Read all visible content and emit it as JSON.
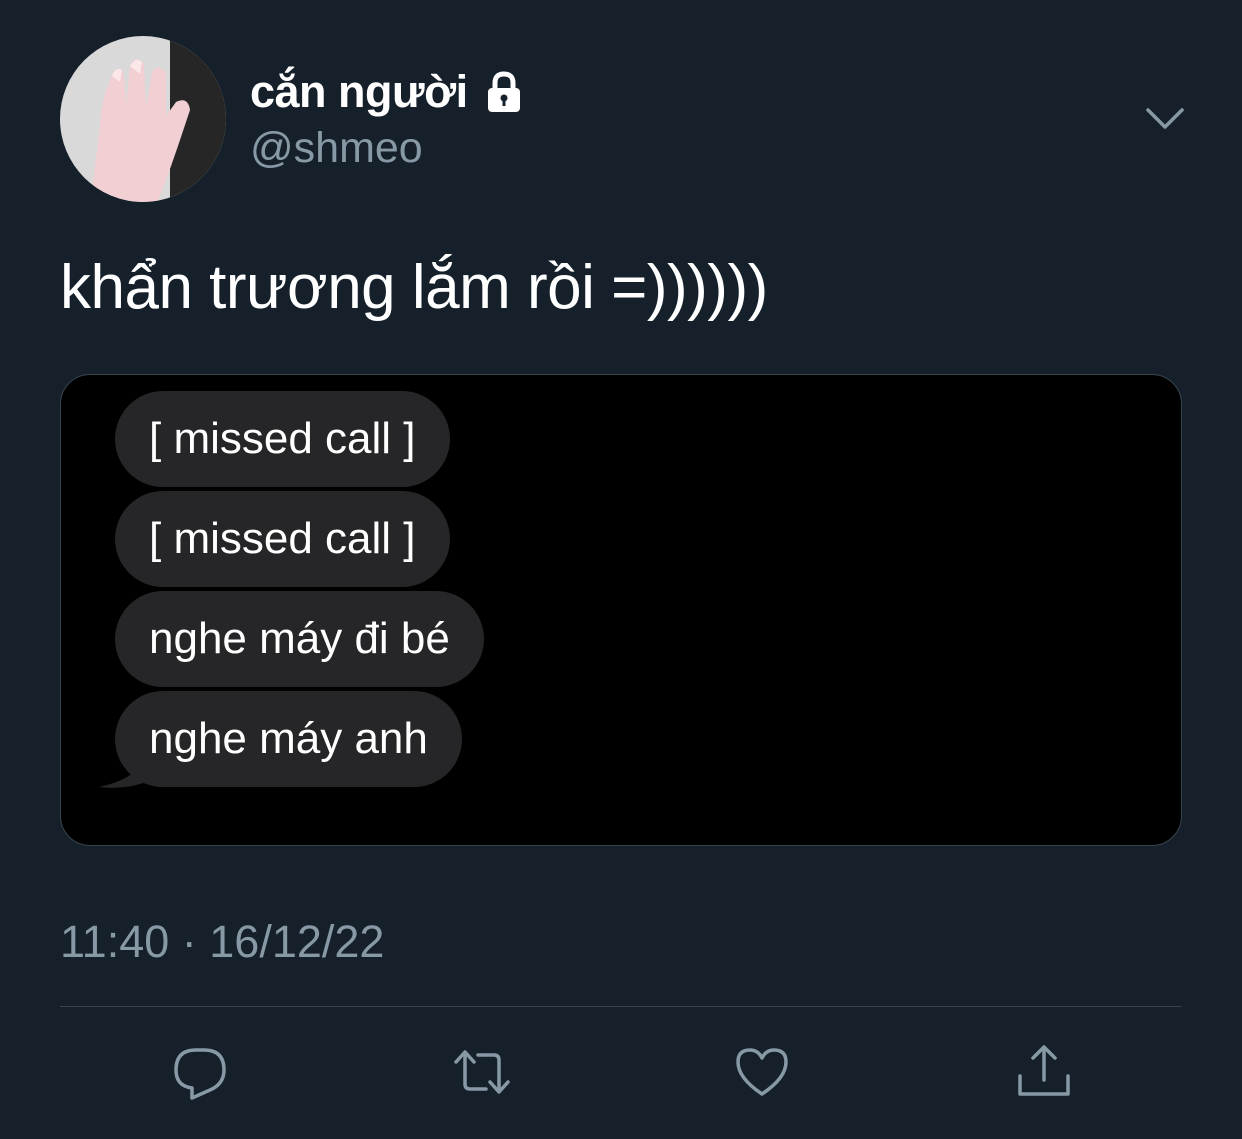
{
  "author": {
    "display_name": "cắn người",
    "handle": "@shmeo",
    "avatar_icon": "avatar-hand-photo",
    "protected_icon": "lock-icon"
  },
  "tweet": {
    "text": "khẩn trương lắm rồi =))))))",
    "timestamp": "11:40 · 16/12/22"
  },
  "media": {
    "messages": [
      "[ missed call ]",
      "[ missed call ]",
      "nghe máy đi bé",
      "nghe máy anh"
    ]
  },
  "actions": {
    "reply_icon": "reply-icon",
    "retweet_icon": "retweet-icon",
    "like_icon": "heart-icon",
    "share_icon": "share-icon"
  },
  "colors": {
    "background": "#15202b",
    "secondary_text": "#8899a6",
    "divider": "#38444d",
    "bubble": "#262628"
  }
}
